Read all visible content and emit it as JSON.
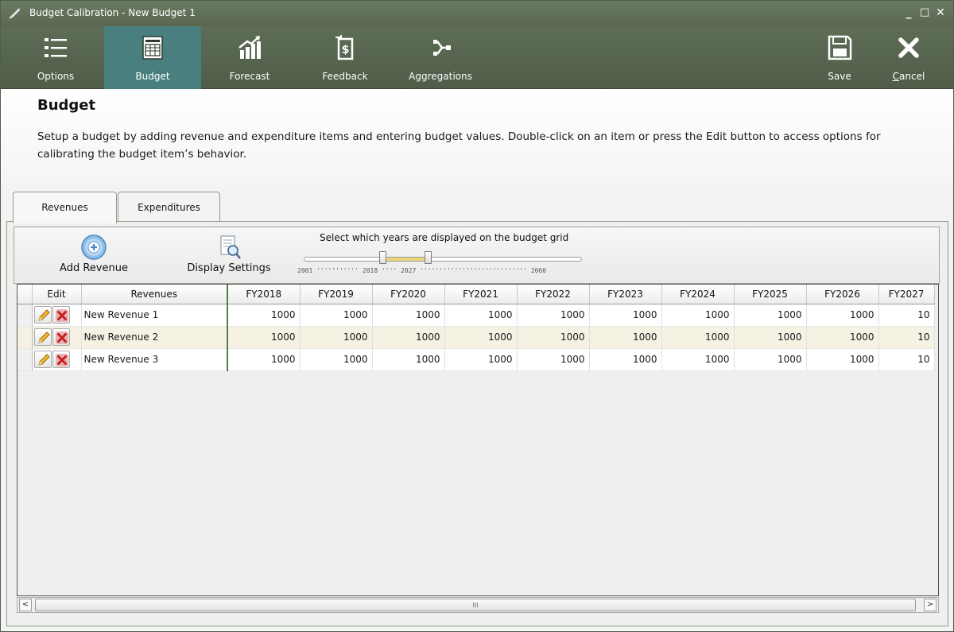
{
  "window": {
    "title": "Budget Calibration - New Budget 1",
    "minimize": "_",
    "maximize": "□",
    "close": "✕"
  },
  "ribbon": {
    "items": [
      {
        "label": "Options",
        "icon": "list-icon"
      },
      {
        "label": "Budget",
        "icon": "budget-sheet-icon",
        "active": true
      },
      {
        "label": "Forecast",
        "icon": "chart-up-icon"
      },
      {
        "label": "Feedback",
        "icon": "dollar-cycle-icon"
      },
      {
        "label": "Aggregations",
        "icon": "merge-icon"
      }
    ],
    "save_label": "Save",
    "cancel_prefix": "C",
    "cancel_rest": "ancel"
  },
  "page": {
    "title": "Budget",
    "description": "Setup a budget by adding revenue and expenditure items and entering budget values. Double-click on an item or press the Edit button to access options for calibrating the budget item’s behavior."
  },
  "tabs": [
    {
      "label": "Revenues",
      "active": true
    },
    {
      "label": "Expenditures",
      "active": false
    }
  ],
  "toolbar": {
    "add_label": "Add Revenue",
    "display_label": "Display Settings",
    "slider_title": "Select which years are displayed on the budget grid",
    "slider_min": "2001",
    "slider_from": "2018",
    "slider_to": "2027",
    "slider_max": "2060"
  },
  "grid": {
    "col_edit": "Edit",
    "col_name": "Revenues",
    "years": [
      "FY2018",
      "FY2019",
      "FY2020",
      "FY2021",
      "FY2022",
      "FY2023",
      "FY2024",
      "FY2025",
      "FY2026",
      "FY2027"
    ],
    "rows": [
      {
        "name": "New Revenue 1",
        "values": [
          "1000",
          "1000",
          "1000",
          "1000",
          "1000",
          "1000",
          "1000",
          "1000",
          "1000",
          "10"
        ]
      },
      {
        "name": "New Revenue 2",
        "values": [
          "1000",
          "1000",
          "1000",
          "1000",
          "1000",
          "1000",
          "1000",
          "1000",
          "1000",
          "10"
        ]
      },
      {
        "name": "New Revenue 3",
        "values": [
          "1000",
          "1000",
          "1000",
          "1000",
          "1000",
          "1000",
          "1000",
          "1000",
          "1000",
          "10"
        ]
      }
    ]
  },
  "scrollbar": {
    "left": "<",
    "right": ">",
    "grip": "III"
  }
}
